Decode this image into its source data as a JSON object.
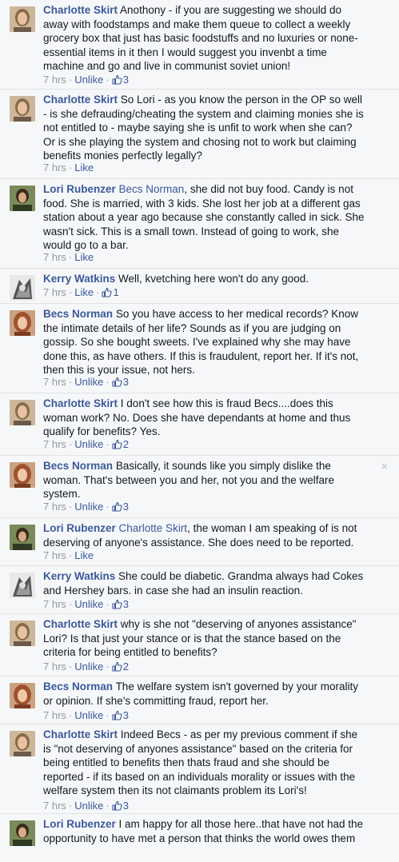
{
  "close_icon_glyph": "×",
  "colors": {
    "link": "#3b5998",
    "meta": "#9197a3",
    "background": "#f6f7f9"
  },
  "comments": [
    {
      "author": "Charlotte Skirt",
      "lines": [
        "Anothony - if you are suggesting we should do",
        "away with foodstamps and make them queue to collect a weekly",
        "grocery box that just has basic foodstuffs and no luxuries or none-",
        "essential items in it then I would suggest you invenbt a time",
        "machine and go and live in communist soviet union!"
      ],
      "time": "7 hrs",
      "action": "Unlike",
      "likes": "3"
    },
    {
      "author": "Charlotte Skirt",
      "lines": [
        "So Lori - as you know the person in the OP so well",
        "- is she defrauding/cheating the system and claiming monies she is",
        "not entitled to - maybe saying she is unfit to work when she can?",
        "Or is she playing the system and chosing not to work but claiming",
        "benefits monies perfectly legally?"
      ],
      "time": "7 hrs",
      "action": "Like",
      "likes": ""
    },
    {
      "author": "Lori Rubenzer",
      "mention": "Becs Norman",
      "lines": [
        ", she did not buy food. Candy is not",
        "food. She is married, with 3 kids. She lost her job at a different gas",
        "station about a year ago because she constantly called in sick. She",
        "wasn't sick. This is a small town. Instead of going to work, she",
        "would go to a bar."
      ],
      "time": "7 hrs",
      "action": "Like",
      "likes": ""
    },
    {
      "author": "Kerry Watkins",
      "lines": [
        "Well, kvetching here won't do any good."
      ],
      "time": "7 hrs",
      "action": "Like",
      "likes": "1"
    },
    {
      "author": "Becs Norman",
      "lines": [
        "So you have access to her medical records? Know",
        "the intimate details of her life? Sounds as if you are judging on",
        "gossip. So she bought sweets. I've explained why she may have",
        "done this, as have others. If this is fraudulent, report her. If it's not,",
        "then this is your issue, not hers."
      ],
      "time": "7 hrs",
      "action": "Unlike",
      "likes": "3"
    },
    {
      "author": "Charlotte Skirt",
      "lines": [
        "I don't see how this is fraud Becs....does this",
        "woman work? No. Does she have dependants at home and thus",
        "qualify for benefits? Yes."
      ],
      "time": "7 hrs",
      "action": "Unlike",
      "likes": "2"
    },
    {
      "author": "Becs Norman",
      "lines": [
        "Basically, it sounds like you simply dislike the",
        "woman. That's between you and her, not you and the welfare",
        "system."
      ],
      "time": "7 hrs",
      "action": "Unlike",
      "likes": "3"
    },
    {
      "author": "Lori Rubenzer",
      "mention": "Charlotte Skirt",
      "lines": [
        ", the woman I am speaking of is not",
        "deserving of anyone's assistance. She does need to be reported."
      ],
      "time": "7 hrs",
      "action": "Like",
      "likes": ""
    },
    {
      "author": "Kerry Watkins",
      "lines": [
        "She could be diabetic. Grandma always had Cokes",
        "and Hershey bars. in case she had an insulin reaction."
      ],
      "time": "7 hrs",
      "action": "Unlike",
      "likes": "3"
    },
    {
      "author": "Charlotte Skirt",
      "lines": [
        "why is she not \"deserving of anyones assistance\"",
        "Lori? Is that just your stance or is that the stance based on the",
        "criteria for being entitled to benefits?"
      ],
      "time": "7 hrs",
      "action": "Unlike",
      "likes": "2"
    },
    {
      "author": "Becs Norman",
      "lines": [
        "The welfare system isn't governed by your morality",
        "or opinion. If she's committing fraud, report her."
      ],
      "time": "7 hrs",
      "action": "Unlike",
      "likes": "3"
    },
    {
      "author": "Charlotte Skirt",
      "lines": [
        "Indeed Becs - as per my previous comment if she",
        "is \"not deserving of anyones assistance\" based on the criteria for",
        "being entitled to benefits then thats fraud and she should be",
        "reported - if its based on an individuals morality or issues with the",
        "welfare system then its not claimants problem its Lori's!"
      ],
      "time": "7 hrs",
      "action": "Unlike",
      "likes": "3"
    },
    {
      "author": "Lori Rubenzer",
      "lines": [
        "I am happy for all those here..that have not had the",
        "opportunity to have met a person that thinks the world owes them"
      ],
      "time": "",
      "action": "",
      "likes": ""
    }
  ]
}
